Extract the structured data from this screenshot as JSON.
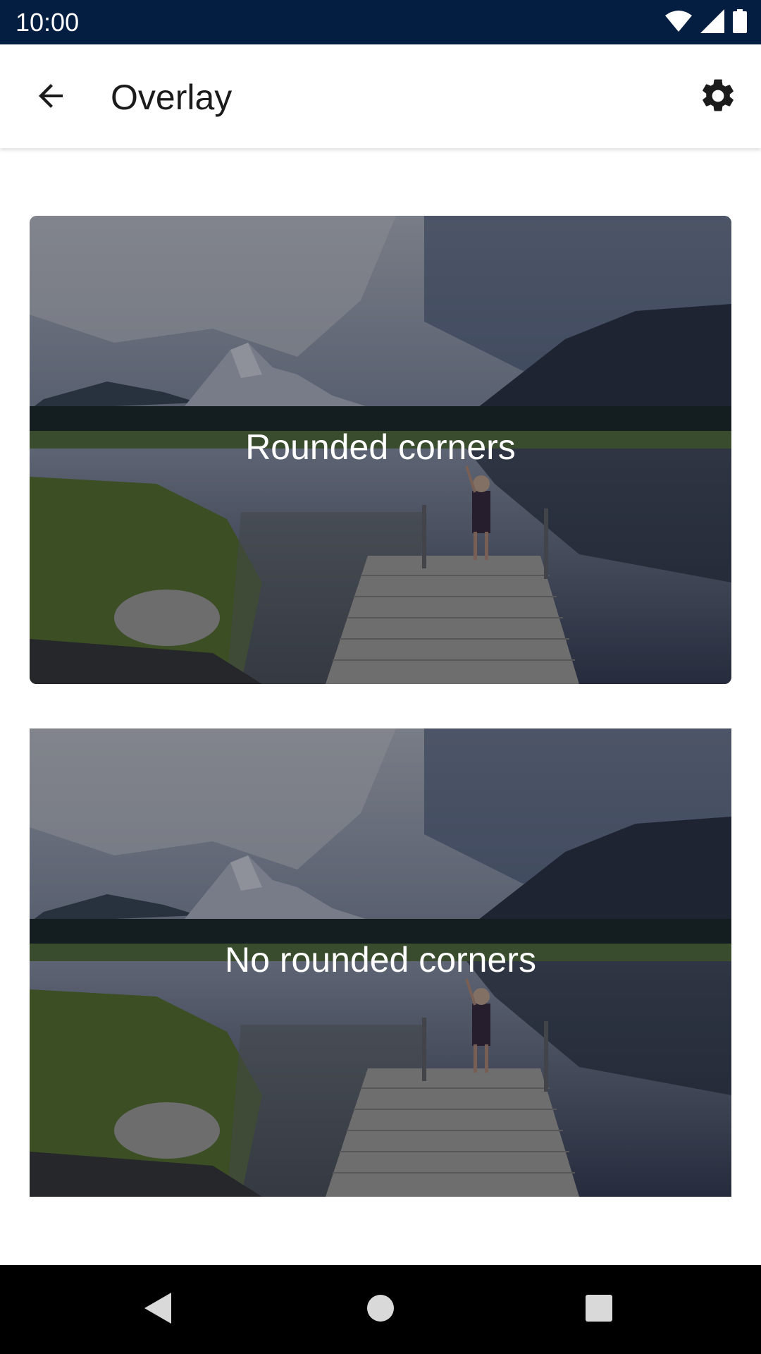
{
  "status_bar": {
    "time": "10:00",
    "icons": [
      "wifi-icon",
      "cellular-signal-icon",
      "battery-icon"
    ]
  },
  "app_bar": {
    "title": "Overlay",
    "back_icon": "arrow-back-icon",
    "settings_icon": "gear-icon"
  },
  "cards": [
    {
      "label": "Rounded corners",
      "image": "lake-dock-mountains-photo"
    },
    {
      "label": "No rounded corners",
      "image": "lake-dock-mountains-photo"
    }
  ],
  "nav_bar": {
    "icons": [
      "back-triangle-icon",
      "home-circle-icon",
      "recents-square-icon"
    ]
  },
  "colors": {
    "status_bar_bg": "#041e42",
    "app_bar_bg": "#ffffff",
    "nav_bar_bg": "#000000",
    "overlay_text": "#ffffff"
  }
}
